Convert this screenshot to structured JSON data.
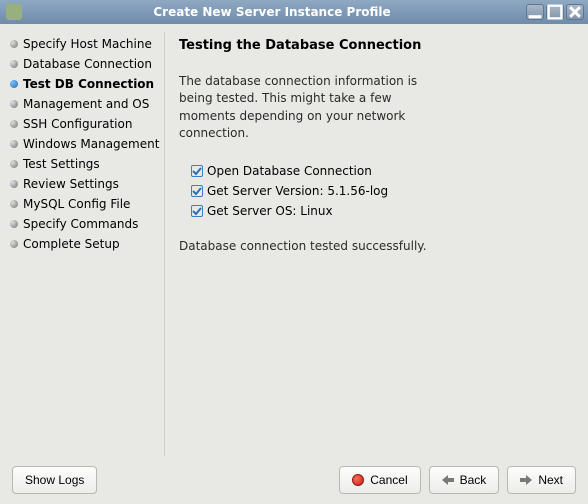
{
  "title": "Create New Server Instance Profile",
  "sidebar": {
    "items": [
      {
        "label": "Specify Host Machine"
      },
      {
        "label": "Database Connection"
      },
      {
        "label": "Test DB Connection"
      },
      {
        "label": "Management and OS"
      },
      {
        "label": "SSH Configuration"
      },
      {
        "label": "Windows Management"
      },
      {
        "label": "Test Settings"
      },
      {
        "label": "Review Settings"
      },
      {
        "label": "MySQL Config File"
      },
      {
        "label": "Specify Commands"
      },
      {
        "label": "Complete Setup"
      }
    ],
    "active_index": 2
  },
  "content": {
    "heading": "Testing the Database Connection",
    "description": "The database connection information is being tested. This might take a few moments depending on your network connection.",
    "checks": [
      {
        "label": "Open Database Connection"
      },
      {
        "label": "Get Server Version: 5.1.56-log"
      },
      {
        "label": "Get Server OS: Linux"
      }
    ],
    "status": "Database connection tested successfully."
  },
  "buttons": {
    "show_logs": "Show Logs",
    "cancel": "Cancel",
    "back": "Back",
    "next": "Next"
  }
}
